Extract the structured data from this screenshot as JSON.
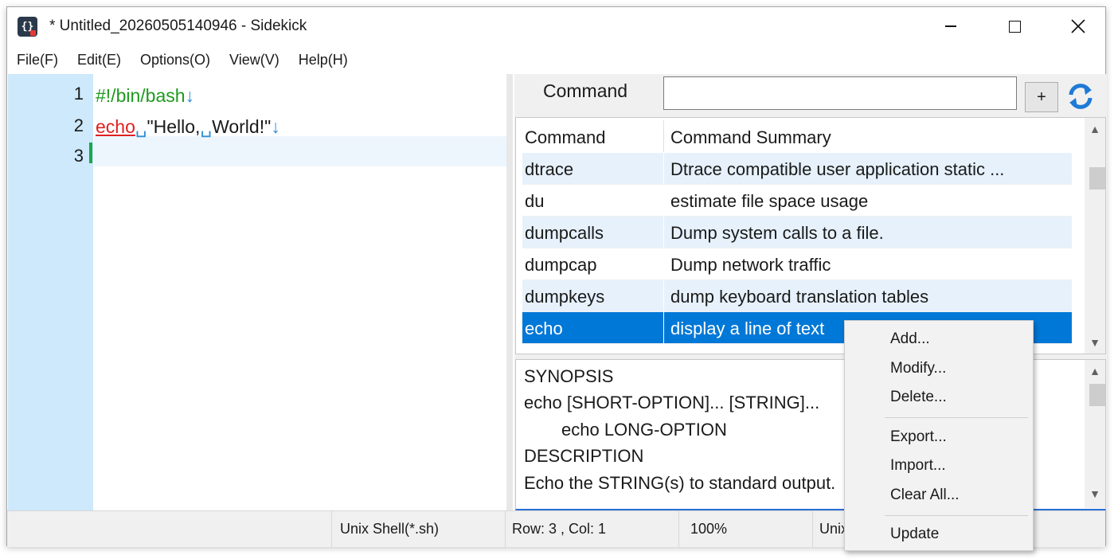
{
  "window": {
    "title": "* Untitled_20260505140946  -  Sidekick"
  },
  "menu": [
    "File(F)",
    "Edit(E)",
    "Options(O)",
    "View(V)",
    "Help(H)"
  ],
  "editor": {
    "lines": [
      {
        "num": "1",
        "text": "#!/bin/bash"
      },
      {
        "num": "2",
        "keyword": "echo",
        "rest": "\"Hello,",
        "rest2": "World!\""
      },
      {
        "num": "3",
        "text": ""
      }
    ],
    "eol_mark": "↓",
    "space_mark": "␣"
  },
  "command_panel": {
    "label": "Command",
    "input_value": "",
    "add_label": "+",
    "columns": [
      "Command",
      "Command Summary"
    ],
    "rows": [
      {
        "cmd": "dtrace",
        "summary": "Dtrace compatible user application static ..."
      },
      {
        "cmd": "du",
        "summary": "estimate file space usage"
      },
      {
        "cmd": "dumpcalls",
        "summary": "Dump system calls to a file."
      },
      {
        "cmd": "dumpcap",
        "summary": "Dump network traffic"
      },
      {
        "cmd": "dumpkeys",
        "summary": "dump keyboard translation tables"
      },
      {
        "cmd": "echo",
        "summary": "display a line of text"
      }
    ],
    "selected_row": 5
  },
  "description": {
    "lines": [
      "SYNOPSIS",
      "echo [SHORT-OPTION]... [STRING]...",
      "echo LONG-OPTION",
      "DESCRIPTION",
      "Echo the STRING(s) to standard output."
    ]
  },
  "status": {
    "language": "Unix Shell(*.sh)",
    "position": "Row: 3 ,  Col: 1",
    "zoom": "100%",
    "eol": "Unix"
  },
  "context_menu": {
    "items": [
      "Add...",
      "Modify...",
      "Delete...",
      "Export...",
      "Import...",
      "Clear All...",
      "Update"
    ]
  },
  "colors": {
    "accent": "#0078d7",
    "gutter": "#cde9fb",
    "comment": "#1e9a1e",
    "keyword": "#e02020"
  }
}
